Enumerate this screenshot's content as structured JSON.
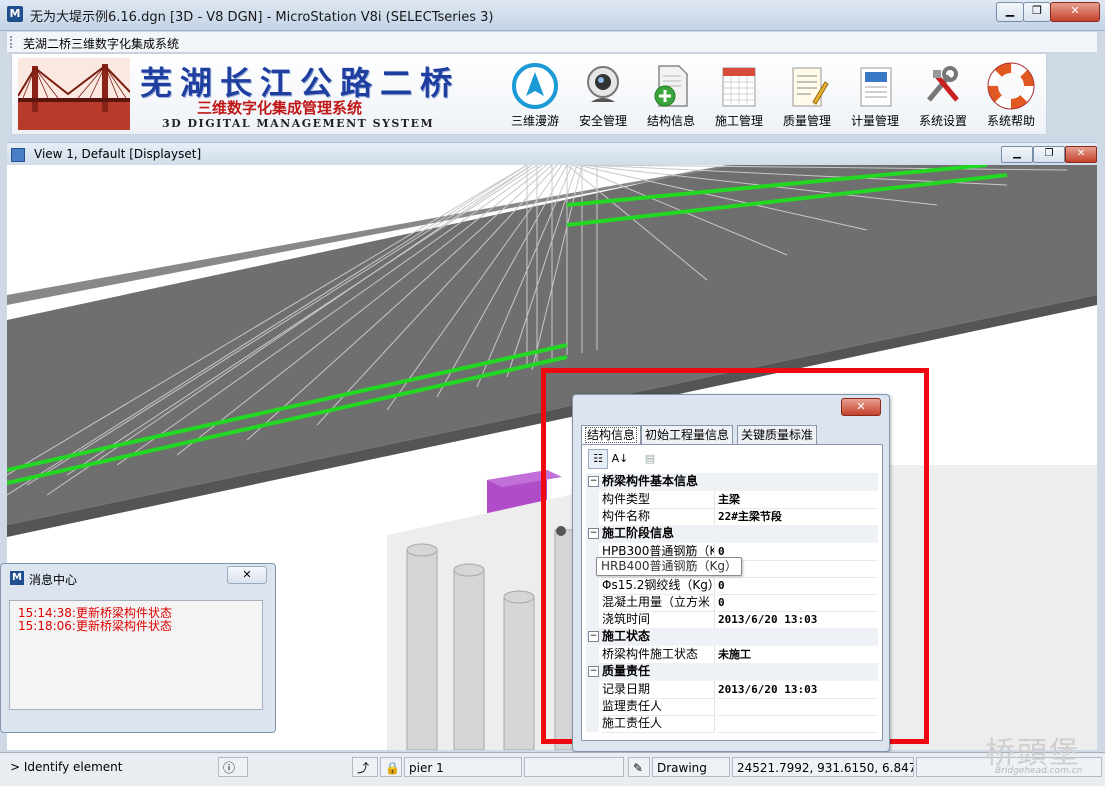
{
  "window": {
    "title": "无为大堤示例6.16.dgn [3D - V8 DGN] - MicroStation V8i (SELECTseries 3)",
    "app_icon_glyph": "M",
    "minimize_glyph": "▁",
    "restore_glyph": "❐",
    "close_glyph": "✕"
  },
  "menubar": {
    "label": "芜湖二桥三维数字化集成系统"
  },
  "banner": {
    "title_cn": "芜湖长江公路二桥",
    "subtitle_cn": "三维数字化集成管理系统",
    "subtitle_en": "3D DIGITAL MANAGEMENT SYSTEM"
  },
  "toolbar": [
    {
      "label": "三维漫游",
      "icon": "compass-icon"
    },
    {
      "label": "安全管理",
      "icon": "webcam-icon"
    },
    {
      "label": "结构信息",
      "icon": "document-add-icon"
    },
    {
      "label": "施工管理",
      "icon": "calendar-icon"
    },
    {
      "label": "质量管理",
      "icon": "notepad-icon"
    },
    {
      "label": "计量管理",
      "icon": "report-icon"
    },
    {
      "label": "系统设置",
      "icon": "tools-icon"
    },
    {
      "label": "系统帮助",
      "icon": "lifebuoy-icon"
    }
  ],
  "view": {
    "title": "View 1, Default [Displayset]"
  },
  "property_panel": {
    "tabs": [
      "结构信息",
      "初始工程量信息",
      "关键质量标准"
    ],
    "active_tab": 0,
    "categories": [
      {
        "name": "桥梁构件基本信息",
        "rows": [
          {
            "key": "构件类型",
            "value": "主梁"
          },
          {
            "key": "构件名称",
            "value": "22#主梁节段"
          }
        ]
      },
      {
        "name": "施工阶段信息",
        "rows": [
          {
            "key": "HPB300普通钢筋（Kg",
            "value": "0"
          },
          {
            "key": "HRB400普通钢筋（Kg）",
            "value": ""
          },
          {
            "key": "Φs15.2钢绞线（Kg）",
            "value": "0"
          },
          {
            "key": "混凝土用量（立方米",
            "value": "0"
          },
          {
            "key": "浇筑时间",
            "value": "2013/6/20 13:03"
          }
        ]
      },
      {
        "name": "施工状态",
        "rows": [
          {
            "key": "桥梁构件施工状态",
            "value": "未施工"
          }
        ]
      },
      {
        "name": "质量责任",
        "rows": [
          {
            "key": "记录日期",
            "value": "2013/6/20 13:03"
          },
          {
            "key": "监理责任人",
            "value": ""
          },
          {
            "key": "施工责任人",
            "value": ""
          }
        ]
      }
    ],
    "tooltip": "HRB400普通钢筋（Kg）"
  },
  "message_center": {
    "title": "消息中心",
    "messages": [
      "15:14:38:更新桥梁构件状态",
      "15:18:06:更新桥梁构件状态"
    ]
  },
  "statusbar": {
    "prompt": "> Identify element",
    "level": "pier 1",
    "mode": "Drawing",
    "coordinates": "24521.7992, 931.6150, 6.8470"
  },
  "watermark": {
    "text": "桥頭堡",
    "sub": "Bridgehead.com.cn"
  },
  "colors": {
    "accent_red": "#f00810",
    "message_red": "#e00000",
    "banner_blue": "#1f3fa0",
    "banner_red": "#c01818",
    "cable_green": "#22d822",
    "deck_gray": "#6f6f6f"
  }
}
